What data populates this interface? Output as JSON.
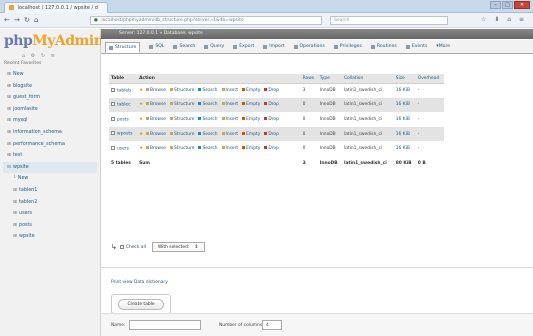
{
  "browser": {
    "tab_title": "localhost / 127.0.0.1 / wpsite / d",
    "address": "localhost/phpmyadmin/db_structure.php?server=1&db=wpsite",
    "search_placeholder": "Search"
  },
  "sidebar": {
    "logo_php": "php",
    "logo_my": "My",
    "logo_admin": "Admin",
    "icons": "⌂ ⚙ ↻ ≡",
    "recent_label": "Recent  Favorites",
    "databases": [
      {
        "label": "New"
      },
      {
        "label": "blogsite"
      },
      {
        "label": "guest_form"
      },
      {
        "label": "joomlasite"
      },
      {
        "label": "mysql"
      },
      {
        "label": "information_schema"
      },
      {
        "label": "performance_schema"
      },
      {
        "label": "test"
      },
      {
        "label": "wpsite"
      }
    ],
    "tables": [
      {
        "label": "New"
      },
      {
        "label": "tablen1"
      },
      {
        "label": "tablen2"
      },
      {
        "label": "users"
      },
      {
        "label": "posts"
      },
      {
        "label": "wpsite"
      }
    ]
  },
  "main": {
    "server_breadcrumb": "Server: 127.0.0.1  »  Database: wpsite",
    "menu": [
      {
        "label": "Structure"
      },
      {
        "label": "SQL"
      },
      {
        "label": "Search"
      },
      {
        "label": "Query"
      },
      {
        "label": "Export"
      },
      {
        "label": "Import"
      },
      {
        "label": "Operations"
      },
      {
        "label": "Privileges"
      },
      {
        "label": "Routines"
      },
      {
        "label": "Events"
      },
      {
        "label": "More"
      }
    ],
    "table_headers": {
      "table": "Table",
      "action": "Action",
      "rows": "Rows",
      "type": "Type",
      "collation": "Collation",
      "size": "Size",
      "overhead": "Overhead"
    },
    "actions": [
      "Browse",
      "Structure",
      "Search",
      "Insert",
      "Empty",
      "Drop"
    ],
    "rows": [
      {
        "name": "tableb",
        "rows": "3",
        "type": "InnoDB",
        "collation": "latin1_swedish_ci",
        "size": "16 KiB",
        "overhead": "-"
      },
      {
        "name": "tablec",
        "rows": "0",
        "type": "InnoDB",
        "collation": "latin1_swedish_ci",
        "size": "16 KiB",
        "overhead": "-"
      },
      {
        "name": "posts",
        "rows": "0",
        "type": "InnoDB",
        "collation": "latin1_swedish_ci",
        "size": "16 KiB",
        "overhead": "-"
      },
      {
        "name": "wposts",
        "rows": "0",
        "type": "InnoDB",
        "collation": "latin1_swedish_ci",
        "size": "16 KiB",
        "overhead": "-"
      },
      {
        "name": "users",
        "rows": "0",
        "type": "InnoDB",
        "collation": "latin1_swedish_ci",
        "size": "16 KiB",
        "overhead": "-"
      }
    ],
    "summary": {
      "label": "5 tables",
      "sum": "Sum",
      "rows": "3",
      "type": "InnoDB",
      "collation": "latin1_swedish_ci",
      "size": "80 KiB",
      "overhead": "0 B"
    },
    "bulk": {
      "check_all": "Check all",
      "with_selected": "With selected:"
    },
    "print_links": "Print view  Data dictionary",
    "create_button": "Create table",
    "create_form": {
      "name_label": "Name:",
      "columns_label": "Number of columns:",
      "columns_value": "4"
    }
  }
}
